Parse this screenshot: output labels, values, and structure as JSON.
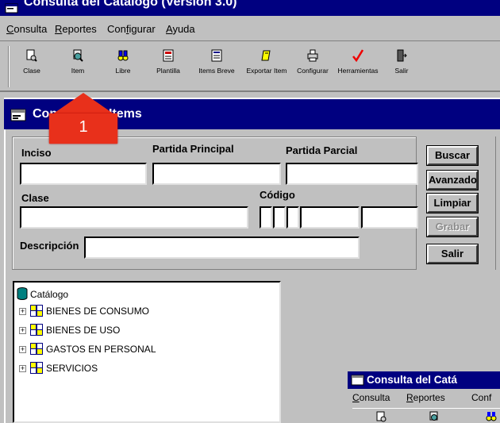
{
  "window": {
    "title": "Consulta del Catálogo (Versión 3.0)"
  },
  "menu": [
    {
      "label": "Consulta",
      "accel": "C",
      "rest": "onsulta"
    },
    {
      "label": "Reportes",
      "accel": "R",
      "rest": "eportes"
    },
    {
      "label": "Configurar",
      "pre": "Con",
      "accel": "f",
      "rest": "igurar"
    },
    {
      "label": "Ayuda",
      "accel": "A",
      "rest": "yuda"
    }
  ],
  "toolbar": [
    {
      "label": "Clase",
      "icon": "document-search-icon"
    },
    {
      "label": "Item",
      "icon": "magnifier-icon"
    },
    {
      "label": "Libre",
      "icon": "binoculars-icon"
    },
    {
      "label": "Plantilla",
      "icon": "template-icon"
    },
    {
      "label": "Items Breve",
      "icon": "list-icon"
    },
    {
      "label": "Exportar Item",
      "icon": "export-icon"
    },
    {
      "label": "Configurar",
      "icon": "printer-icon"
    },
    {
      "label": "Herramientas",
      "icon": "check-tool-icon"
    },
    {
      "label": "Salir",
      "icon": "exit-door-icon"
    }
  ],
  "child_window": {
    "title": "Consulta de Items"
  },
  "form": {
    "inciso_label": "Inciso",
    "partida_principal_label": "Partida Principal",
    "partida_parcial_label": "Partida Parcial",
    "clase_label": "Clase",
    "codigo_label": "Código",
    "descripcion_label": "Descripción",
    "inciso_value": "",
    "partida_principal_value": "",
    "partida_parcial_value": "",
    "clase_value": "",
    "descripcion_value": ""
  },
  "buttons": {
    "buscar": "Buscar",
    "avanzado": "Avanzado",
    "limpiar": "Limpiar",
    "grabar": "Grabar",
    "salir": "Salir"
  },
  "tree": {
    "root": "Catálogo",
    "items": [
      "BIENES DE CONSUMO",
      "BIENES DE USO",
      "GASTOS EN PERSONAL",
      "SERVICIOS"
    ]
  },
  "callout": {
    "number": "1",
    "color": "#e8301b"
  },
  "mini_window": {
    "title": "Consulta del Catá",
    "menu": [
      {
        "accel": "C",
        "rest": "onsulta"
      },
      {
        "accel": "R",
        "rest": "eportes"
      },
      {
        "pre": "Conf",
        "accel": "",
        "rest": ""
      }
    ]
  },
  "colors": {
    "titlebar": "#000080",
    "face": "#c0c0c0",
    "highlight": "#e8301b"
  }
}
